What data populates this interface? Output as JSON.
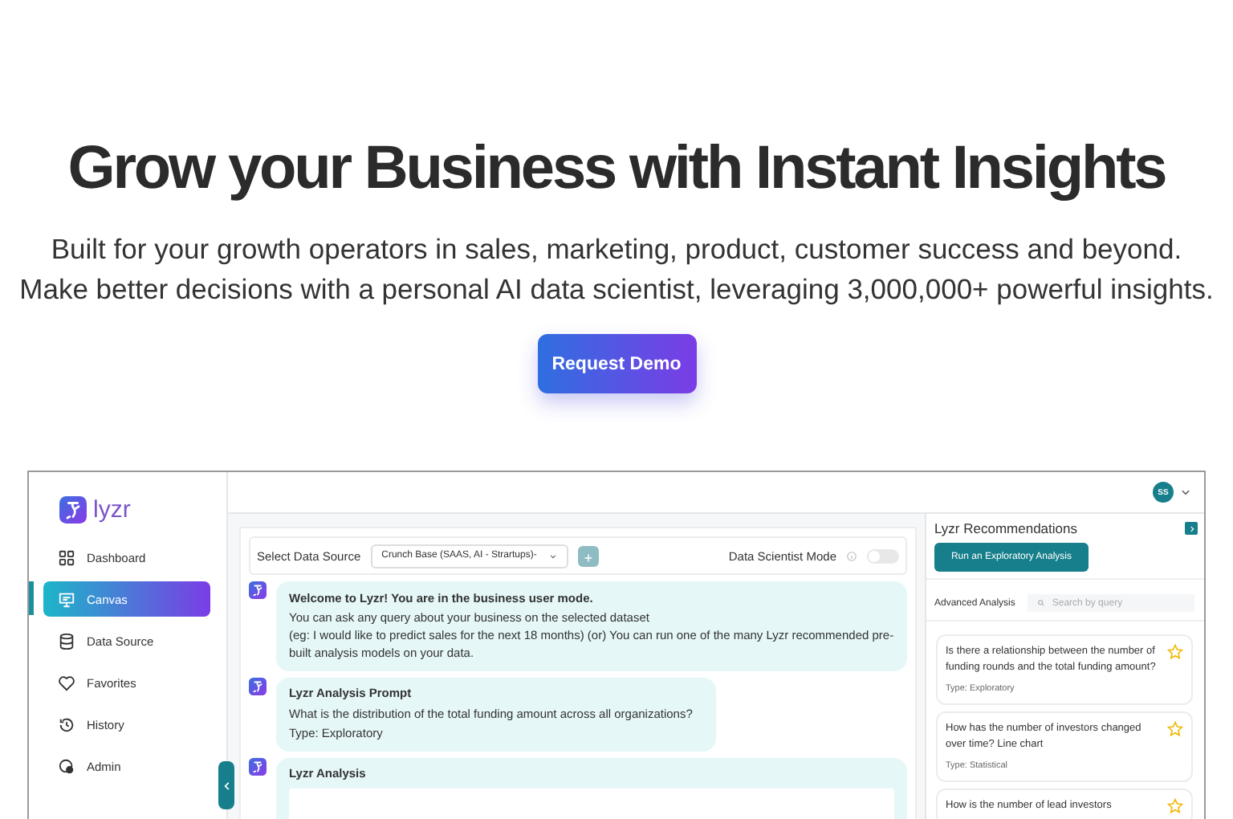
{
  "hero": {
    "title": "Grow your Business with Instant Insights",
    "subtitle_lines": [
      "Built for your growth operators in sales, marketing, product, customer success and beyond.",
      "Make better decisions with a personal AI data scientist, leveraging 3,000,000+ powerful insights."
    ],
    "button": "Request Demo"
  },
  "app": {
    "logo": "lyzr",
    "nav": [
      {
        "label": "Dashboard",
        "selected": false
      },
      {
        "label": "Canvas",
        "selected": true
      },
      {
        "label": "Data Source",
        "selected": false
      },
      {
        "label": "Favorites",
        "selected": false
      },
      {
        "label": "History",
        "selected": false
      },
      {
        "label": "Admin",
        "selected": false
      }
    ],
    "user": {
      "initials": "SS"
    },
    "toolbar": {
      "label": "Select Data Source",
      "source": "Crunch Base (SAAS, AI - Strartups)-",
      "mode_label": "Data Scientist Mode",
      "mode_on": false
    },
    "messages": [
      {
        "kind": "text",
        "title": "Welcome to Lyzr! You are in the business user mode.",
        "lines": [
          "You can ask any query about your business on the selected dataset",
          "(eg: I would like to predict sales for the next 18 months) (or) You can run one of the many Lyzr recommended pre-built analysis models on your data."
        ]
      },
      {
        "kind": "prompt",
        "title": "Lyzr Analysis Prompt",
        "lines": [
          "What is the distribution of the total funding amount across all organizations?",
          "Type: Exploratory"
        ]
      },
      {
        "kind": "analysis",
        "title": "Lyzr Analysis"
      }
    ],
    "recommendations": {
      "title": "Lyzr Recommendations",
      "run_button": "Run an Exploratory Analysis",
      "section_label": "Advanced Analysis",
      "search_placeholder": "Search by query",
      "cards": [
        {
          "question": "Is there a relationship between the number of funding rounds and the total funding amount?",
          "type": "Type:  Exploratory",
          "starred": false
        },
        {
          "question": "How has the number of investors changed over time? Line chart",
          "type": "Type:  Statistical",
          "starred": false
        },
        {
          "question": "How is the number of lead investors",
          "starred": false
        }
      ]
    }
  }
}
